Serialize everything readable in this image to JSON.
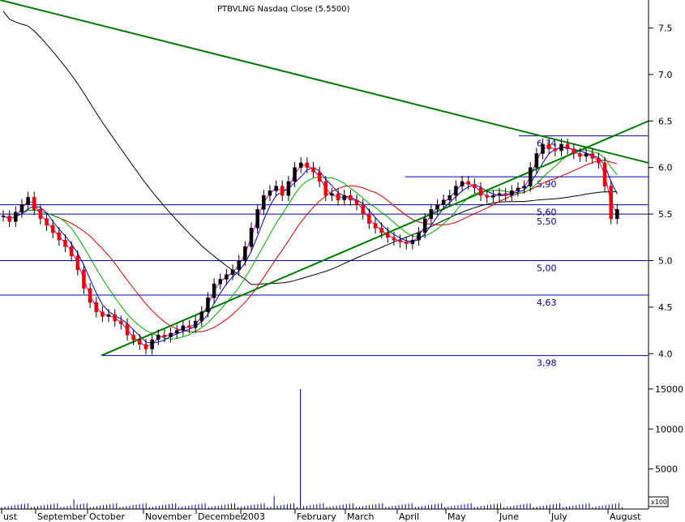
{
  "chart_data": {
    "type": "candlestick",
    "title": "PTBVLNG Nasdaq Close (5.5500)",
    "price_axis": {
      "ticks": [
        "4.0",
        "4.5",
        "5.0",
        "5.5",
        "6.0",
        "6.5",
        "7.0",
        "7.5"
      ],
      "range": [
        3.75,
        7.8
      ]
    },
    "volume_axis": {
      "ticks": [
        "5000",
        "10000",
        "15000"
      ],
      "range": [
        0,
        16000
      ],
      "multiplier_label": "x100"
    },
    "x_axis": {
      "labels": [
        "ust",
        "September",
        "October",
        "November",
        "December",
        "2003",
        "February",
        "March",
        "April",
        "May",
        "June",
        "July",
        "August"
      ]
    },
    "horizontal_levels": [
      {
        "value": 6.34,
        "label": "6,34"
      },
      {
        "value": 5.9,
        "label": "5,90"
      },
      {
        "value": 5.6,
        "label": "5,60"
      },
      {
        "value": 5.5,
        "label": "5,50"
      },
      {
        "value": 5.0,
        "label": "5,00"
      },
      {
        "value": 4.63,
        "label": "4,63"
      },
      {
        "value": 3.98,
        "label": "3,98"
      }
    ],
    "trendlines": [
      {
        "name": "resistance",
        "color": "#007a00",
        "from_price": 7.8,
        "to_price": 6.05
      },
      {
        "name": "support",
        "color": "#007a00",
        "from_price": 3.98,
        "to_price": 6.5
      }
    ],
    "price_series": {
      "close": [
        5.48,
        5.42,
        5.52,
        5.6,
        5.68,
        5.55,
        5.45,
        5.38,
        5.3,
        5.22,
        5.15,
        5.05,
        4.9,
        4.7,
        4.55,
        4.45,
        4.4,
        4.42,
        4.35,
        4.32,
        4.2,
        4.15,
        4.1,
        4.05,
        4.15,
        4.2,
        4.18,
        4.22,
        4.25,
        4.3,
        4.28,
        4.35,
        4.45,
        4.6,
        4.75,
        4.8,
        4.85,
        4.9,
        5.0,
        5.15,
        5.35,
        5.55,
        5.7,
        5.75,
        5.8,
        5.7,
        5.85,
        6.0,
        6.05,
        6.0,
        5.95,
        5.85,
        5.7,
        5.72,
        5.65,
        5.7,
        5.65,
        5.6,
        5.5,
        5.4,
        5.35,
        5.3,
        5.25,
        5.22,
        5.2,
        5.18,
        5.22,
        5.3,
        5.45,
        5.55,
        5.6,
        5.65,
        5.7,
        5.8,
        5.85,
        5.82,
        5.78,
        5.7,
        5.68,
        5.7,
        5.72,
        5.7,
        5.75,
        5.78,
        5.8,
        6.0,
        6.15,
        6.25,
        6.2,
        6.18,
        6.25,
        6.2,
        6.15,
        6.12,
        6.15,
        6.1,
        6.05,
        5.8,
        5.45,
        5.55
      ]
    },
    "moving_averages": [
      {
        "color": "#000000"
      },
      {
        "color": "#cc0000"
      },
      {
        "color": "#00aa00"
      },
      {
        "color": "#0000cc"
      },
      {
        "color": "#cc00cc"
      }
    ],
    "volume_spikes": [
      {
        "bar": 47,
        "value": 15000
      }
    ]
  }
}
